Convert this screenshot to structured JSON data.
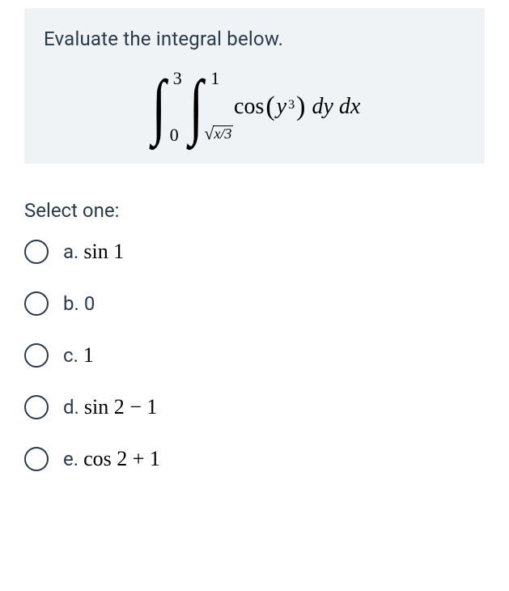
{
  "question": {
    "prompt": "Evaluate the integral below.",
    "integral": {
      "outer_lower": "0",
      "outer_upper": "3",
      "inner_lower_radicand": "x/3",
      "inner_upper": "1",
      "integrand_func": "cos",
      "integrand_var": "y",
      "integrand_pow": "3",
      "differentials": "dy dx"
    }
  },
  "select_label": "Select one:",
  "options": {
    "a": {
      "letter": "a.",
      "text": "sin 1"
    },
    "b": {
      "letter": "b.",
      "text": "0"
    },
    "c": {
      "letter": "c.",
      "text": "1"
    },
    "d": {
      "letter": "d.",
      "text": "sin 2 − 1"
    },
    "e": {
      "letter": "e.",
      "text": "cos 2 + 1"
    }
  }
}
